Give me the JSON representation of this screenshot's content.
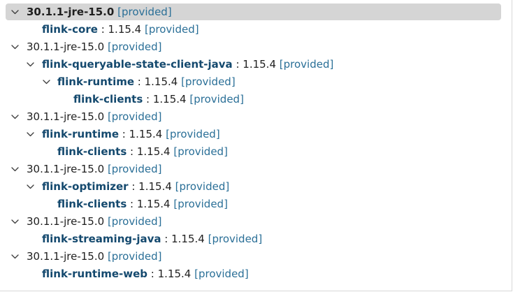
{
  "tree": {
    "nodes": [
      {
        "depth": 0,
        "expanded": true,
        "selected": true,
        "icon": "chevron-down-icon",
        "name": "30.1.1-jre-15.0",
        "scope": "[provided]"
      },
      {
        "depth": 1,
        "expanded": false,
        "artifact": "flink-core",
        "sep": " : ",
        "version": "1.15.4",
        "scope": "[provided]"
      },
      {
        "depth": 0,
        "expanded": true,
        "icon": "chevron-down-icon",
        "name": "30.1.1-jre-15.0",
        "scope": "[provided]"
      },
      {
        "depth": 1,
        "expanded": true,
        "icon": "chevron-down-icon",
        "artifact": "flink-queryable-state-client-java",
        "sep": " : ",
        "version": "1.15.4",
        "scope": "[provided]"
      },
      {
        "depth": 2,
        "expanded": true,
        "icon": "chevron-down-icon",
        "artifact": "flink-runtime",
        "sep": " : ",
        "version": "1.15.4",
        "scope": "[provided]"
      },
      {
        "depth": 3,
        "expanded": false,
        "artifact": "flink-clients",
        "sep": " : ",
        "version": "1.15.4",
        "scope": "[provided]"
      },
      {
        "depth": 0,
        "expanded": true,
        "icon": "chevron-down-icon",
        "name": "30.1.1-jre-15.0",
        "scope": "[provided]"
      },
      {
        "depth": 1,
        "expanded": true,
        "icon": "chevron-down-icon",
        "artifact": "flink-runtime",
        "sep": " : ",
        "version": "1.15.4",
        "scope": "[provided]"
      },
      {
        "depth": 2,
        "expanded": false,
        "artifact": "flink-clients",
        "sep": " : ",
        "version": "1.15.4",
        "scope": "[provided]"
      },
      {
        "depth": 0,
        "expanded": true,
        "icon": "chevron-down-icon",
        "name": "30.1.1-jre-15.0",
        "scope": "[provided]"
      },
      {
        "depth": 1,
        "expanded": true,
        "icon": "chevron-down-icon",
        "artifact": "flink-optimizer",
        "sep": " : ",
        "version": "1.15.4",
        "scope": "[provided]"
      },
      {
        "depth": 2,
        "expanded": false,
        "artifact": "flink-clients",
        "sep": " : ",
        "version": "1.15.4",
        "scope": "[provided]"
      },
      {
        "depth": 0,
        "expanded": true,
        "icon": "chevron-down-icon",
        "name": "30.1.1-jre-15.0",
        "scope": "[provided]"
      },
      {
        "depth": 1,
        "expanded": false,
        "artifact": "flink-streaming-java",
        "sep": " : ",
        "version": "1.15.4",
        "scope": "[provided]"
      },
      {
        "depth": 0,
        "expanded": true,
        "icon": "chevron-down-icon",
        "name": "30.1.1-jre-15.0",
        "scope": "[provided]"
      },
      {
        "depth": 1,
        "expanded": false,
        "artifact": "flink-runtime-web",
        "sep": " : ",
        "version": "1.15.4",
        "scope": "[provided]"
      }
    ]
  }
}
